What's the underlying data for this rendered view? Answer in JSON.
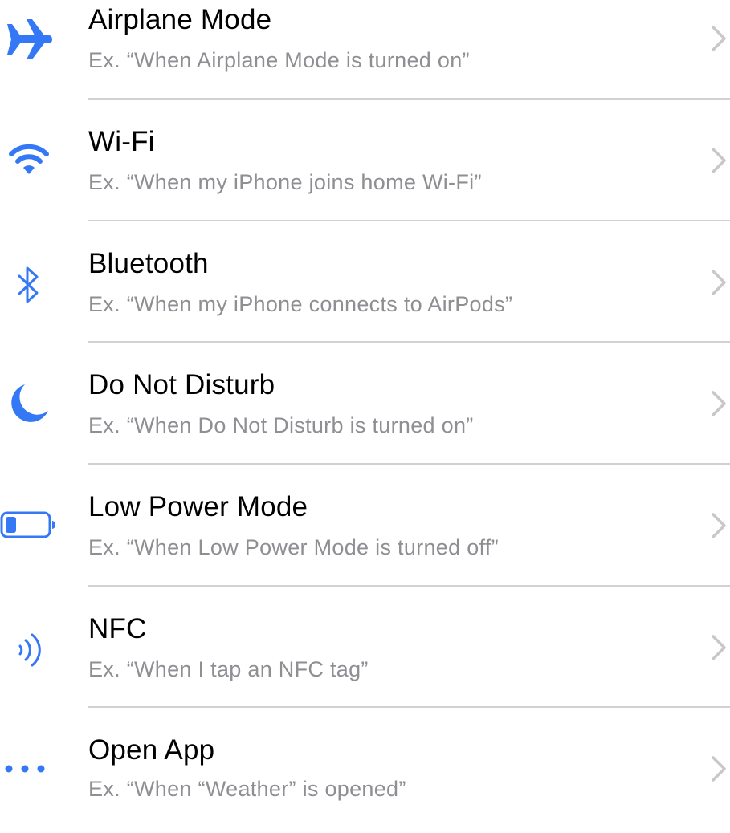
{
  "accent_color": "#3478f6",
  "title_color": "#000000",
  "subtitle_color": "#8e8e93",
  "chevron_color": "#c7c7cc",
  "triggers": [
    {
      "icon": "airplane-icon",
      "title": "Airplane Mode",
      "subtitle": "Ex. “When Airplane Mode is turned on”"
    },
    {
      "icon": "wifi-icon",
      "title": "Wi-Fi",
      "subtitle": "Ex. “When my iPhone joins home Wi-Fi”"
    },
    {
      "icon": "bluetooth-icon",
      "title": "Bluetooth",
      "subtitle": "Ex. “When my iPhone connects to AirPods”"
    },
    {
      "icon": "moon-icon",
      "title": "Do Not Disturb",
      "subtitle": "Ex. “When Do Not Disturb is turned on”"
    },
    {
      "icon": "battery-icon",
      "title": "Low Power Mode",
      "subtitle": "Ex. “When Low Power Mode is turned off”"
    },
    {
      "icon": "nfc-icon",
      "title": "NFC",
      "subtitle": "Ex. “When I tap an NFC tag”"
    },
    {
      "icon": "ellipsis-icon",
      "title": "Open App",
      "subtitle": "Ex. “When “Weather” is opened”"
    }
  ]
}
